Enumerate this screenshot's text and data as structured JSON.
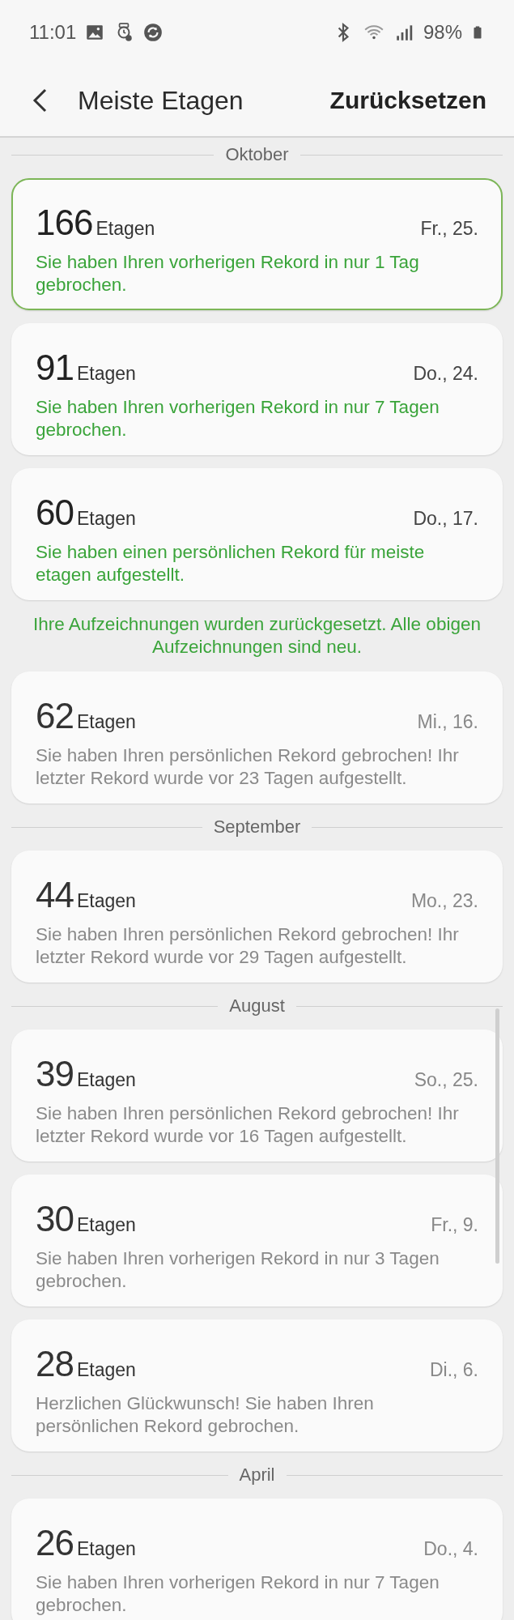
{
  "status_bar": {
    "time": "11:01",
    "battery": "98%"
  },
  "header": {
    "title": "Meiste Etagen",
    "action": "Zurücksetzen"
  },
  "sections": [
    {
      "month": "Oktober",
      "entries": [
        {
          "kind": "record",
          "floors": "166",
          "unit": "Etagen",
          "date": "Fr., 25.",
          "message": "Sie haben Ihren vorherigen Rekord in nur 1 Tag gebrochen.",
          "new": true,
          "highlighted": true
        },
        {
          "kind": "record",
          "floors": "91",
          "unit": "Etagen",
          "date": "Do., 24.",
          "message": "Sie haben Ihren vorherigen Rekord in nur 7 Tagen gebrochen.",
          "new": true,
          "highlighted": false
        },
        {
          "kind": "record",
          "floors": "60",
          "unit": "Etagen",
          "date": "Do., 17.",
          "message": "Sie haben einen persönlichen Rekord für meiste etagen aufgestellt.",
          "new": true,
          "highlighted": false
        },
        {
          "kind": "notice",
          "text": "Ihre Aufzeichnungen wurden zurückgesetzt. Alle obigen Aufzeichnungen sind neu."
        },
        {
          "kind": "record",
          "floors": "62",
          "unit": "Etagen",
          "date": "Mi., 16.",
          "message": "Sie haben Ihren persönlichen Rekord gebrochen! Ihr letzter Rekord wurde vor 23 Tagen aufgestellt.",
          "new": false,
          "highlighted": false
        }
      ]
    },
    {
      "month": "September",
      "entries": [
        {
          "kind": "record",
          "floors": "44",
          "unit": "Etagen",
          "date": "Mo., 23.",
          "message": "Sie haben Ihren persönlichen Rekord gebrochen! Ihr letzter Rekord wurde vor 29 Tagen aufgestellt.",
          "new": false,
          "highlighted": false
        }
      ]
    },
    {
      "month": "August",
      "entries": [
        {
          "kind": "record",
          "floors": "39",
          "unit": "Etagen",
          "date": "So., 25.",
          "message": "Sie haben Ihren persönlichen Rekord gebrochen! Ihr letzter Rekord wurde vor 16 Tagen aufgestellt.",
          "new": false,
          "highlighted": false
        },
        {
          "kind": "record",
          "floors": "30",
          "unit": "Etagen",
          "date": "Fr., 9.",
          "message": "Sie haben Ihren vorherigen Rekord in nur 3 Tagen gebrochen.",
          "new": false,
          "highlighted": false
        },
        {
          "kind": "record",
          "floors": "28",
          "unit": "Etagen",
          "date": "Di., 6.",
          "message": "Herzlichen Glückwunsch! Sie haben Ihren persönlichen Rekord gebrochen.",
          "new": false,
          "highlighted": false
        }
      ]
    },
    {
      "month": "April",
      "entries": [
        {
          "kind": "record",
          "floors": "26",
          "unit": "Etagen",
          "date": "Do., 4.",
          "message": "Sie haben Ihren vorherigen Rekord in nur 7 Tagen gebrochen.",
          "new": false,
          "highlighted": false
        }
      ]
    }
  ]
}
